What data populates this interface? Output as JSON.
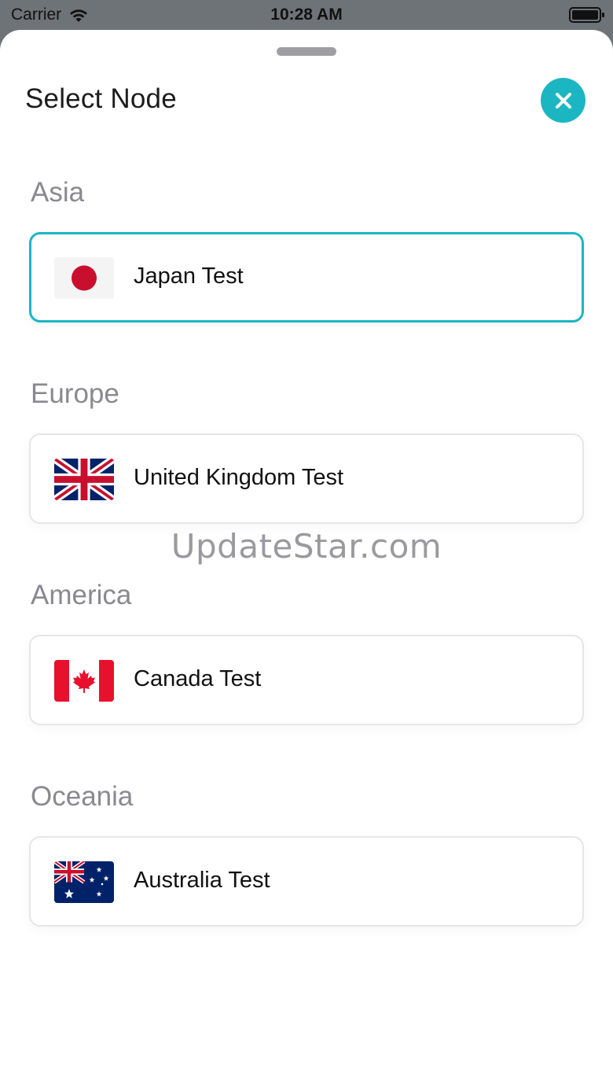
{
  "status_bar": {
    "carrier": "Carrier",
    "time": "10:28 AM",
    "wifi_icon": "wifi-icon",
    "battery_icon": "battery-icon"
  },
  "sheet": {
    "title": "Select Node",
    "close_icon": "close-icon",
    "accent_color": "#1bb6c1"
  },
  "sections": [
    {
      "label": "Asia",
      "nodes": [
        {
          "name": "Japan Test",
          "flag_icon": "japan-flag-icon",
          "selected": true
        }
      ]
    },
    {
      "label": "Europe",
      "nodes": [
        {
          "name": "United Kingdom Test",
          "flag_icon": "uk-flag-icon",
          "selected": false
        }
      ]
    },
    {
      "label": "America",
      "nodes": [
        {
          "name": "Canada Test",
          "flag_icon": "canada-flag-icon",
          "selected": false
        }
      ]
    },
    {
      "label": "Oceania",
      "nodes": [
        {
          "name": "Australia Test",
          "flag_icon": "australia-flag-icon",
          "selected": false
        }
      ]
    }
  ],
  "watermark": "UpdateStar.com"
}
